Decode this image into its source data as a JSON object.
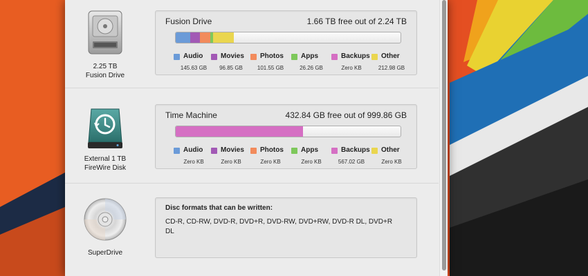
{
  "legend_categories": [
    {
      "key": "audio",
      "label": "Audio",
      "color": "#6b9bd8"
    },
    {
      "key": "movies",
      "label": "Movies",
      "color": "#a259b5"
    },
    {
      "key": "photos",
      "label": "Photos",
      "color": "#f28b5c"
    },
    {
      "key": "apps",
      "label": "Apps",
      "color": "#7ec85b"
    },
    {
      "key": "backups",
      "label": "Backups",
      "color": "#d56fc3"
    },
    {
      "key": "other",
      "label": "Other",
      "color": "#ead64f"
    }
  ],
  "drives": [
    {
      "icon": "hard-drive-icon",
      "caption_line1": "2.25 TB",
      "caption_line2": "Fusion Drive",
      "name": "Fusion Drive",
      "free_text": "1.66 TB free out of 2.24 TB",
      "sizes": [
        "145.63 GB",
        "96.85 GB",
        "101.55 GB",
        "26.26 GB",
        "Zero KB",
        "212.98 GB"
      ],
      "usage_fraction": [
        0.065,
        0.043,
        0.045,
        0.012,
        0.0,
        0.095
      ]
    },
    {
      "icon": "time-machine-drive-icon",
      "caption_line1": "External 1 TB",
      "caption_line2": "FireWire Disk",
      "name": "Time Machine",
      "free_text": "432.84 GB free out of 999.86 GB",
      "sizes": [
        "Zero KB",
        "Zero KB",
        "Zero KB",
        "Zero KB",
        "567.02 GB",
        "Zero KB"
      ],
      "usage_fraction": [
        0,
        0,
        0,
        0,
        0.567,
        0
      ]
    }
  ],
  "superdrive": {
    "icon": "optical-disc-icon",
    "caption": "SuperDrive",
    "heading": "Disc formats that can be written:",
    "formats": "CD-R, CD-RW, DVD-R, DVD+R, DVD-RW, DVD+RW, DVD-R DL, DVD+R DL"
  }
}
